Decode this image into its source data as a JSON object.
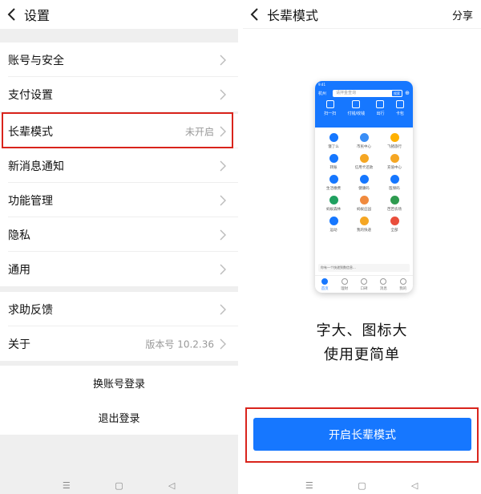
{
  "settings": {
    "title": "设置",
    "items": [
      {
        "label": "账号与安全"
      },
      {
        "label": "支付设置"
      },
      {
        "label": "长辈模式",
        "value": "未开启"
      },
      {
        "label": "新消息通知"
      },
      {
        "label": "功能管理"
      },
      {
        "label": "隐私"
      },
      {
        "label": "通用"
      },
      {
        "label": "求助反馈"
      },
      {
        "label": "关于",
        "value": "版本号 10.2.36"
      }
    ],
    "switch_account": "换账号登录",
    "logout": "退出登录"
  },
  "elder_mode": {
    "title": "长辈模式",
    "share": "分享",
    "tagline_1": "字大、图标大",
    "tagline_2": "使用更简单",
    "enable_button": "开启长辈模式",
    "preview": {
      "status_time": "9:41",
      "city": "杭州",
      "search_placeholder": "请拌金查询",
      "search_button": "搜索",
      "features": [
        "扫一扫",
        "付钱/收钱",
        "出行",
        "卡包"
      ],
      "apps": [
        "饿了么",
        "市民中心",
        "飞猪旅行",
        "转账",
        "信用卡还款",
        "充值中心",
        "生活缴费",
        "健康码",
        "医保码",
        "蚂蚁森林",
        "蚂蚁庄园",
        "芭芭农场",
        "运动",
        "我的快递",
        "全部"
      ],
      "message": "你有一个快递到数信息...",
      "tabs": [
        "首页",
        "理财",
        "口碑",
        "消息",
        "我的"
      ]
    }
  },
  "system_nav": {
    "menu": "☰",
    "home": "▢",
    "back": "◁"
  },
  "colors": {
    "accent": "#1677ff",
    "highlight": "#d9241c",
    "chevron": "#bbbbbb",
    "secondary_text": "#999999"
  }
}
